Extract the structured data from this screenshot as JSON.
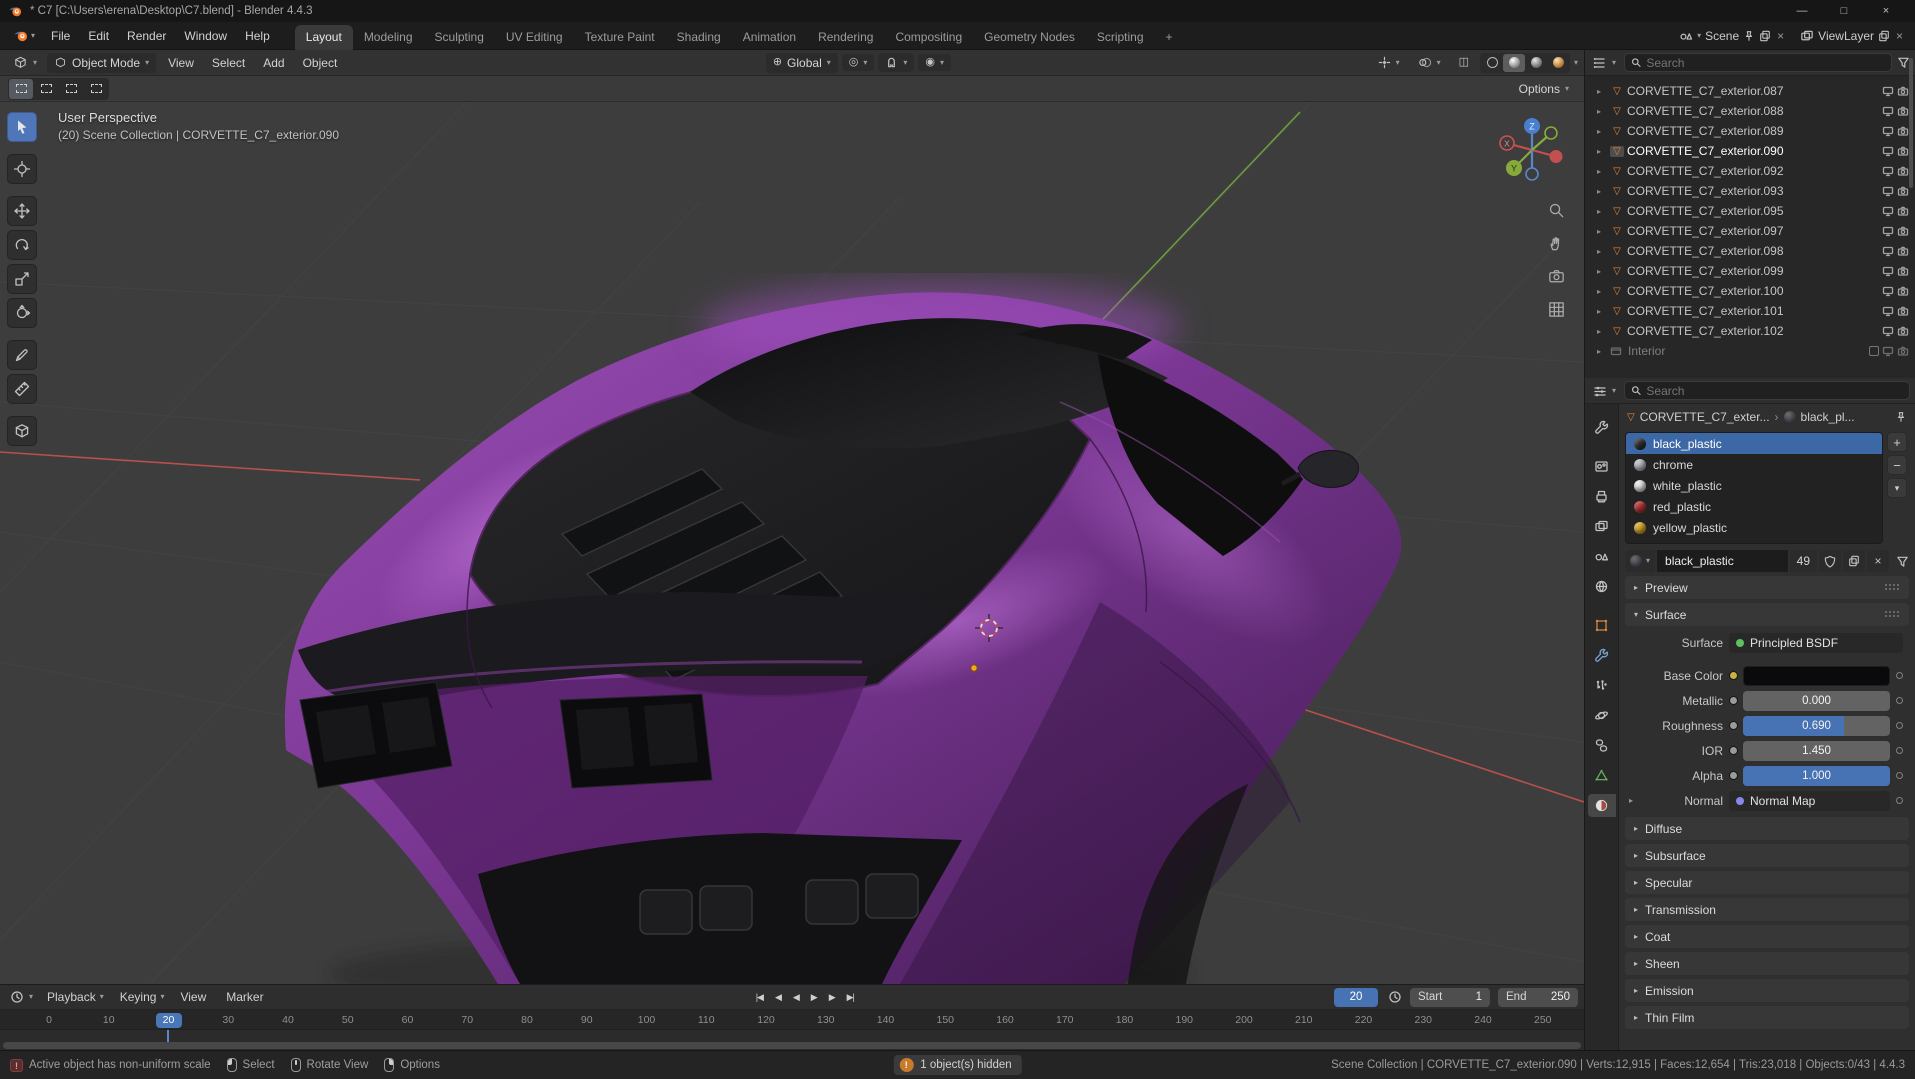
{
  "window": {
    "title": "* C7 [C:\\Users\\erena\\Desktop\\C7.blend] - Blender 4.4.3",
    "controls": {
      "minimize": "—",
      "maximize": "□",
      "close": "×"
    }
  },
  "topbar": {
    "menus": [
      "File",
      "Edit",
      "Render",
      "Window",
      "Help"
    ],
    "workspaces": [
      {
        "label": "Layout",
        "active": true
      },
      {
        "label": "Modeling"
      },
      {
        "label": "Sculpting"
      },
      {
        "label": "UV Editing"
      },
      {
        "label": "Texture Paint"
      },
      {
        "label": "Shading"
      },
      {
        "label": "Animation"
      },
      {
        "label": "Rendering"
      },
      {
        "label": "Compositing"
      },
      {
        "label": "Geometry Nodes"
      },
      {
        "label": "Scripting"
      },
      {
        "label": "+"
      }
    ],
    "scene_label": "Scene",
    "view_layer_label": "ViewLayer"
  },
  "viewport": {
    "mode": "Object Mode",
    "menus": [
      "View",
      "Select",
      "Add",
      "Object"
    ],
    "orientation": "Global",
    "options_label": "Options",
    "overlay_line1": "User Perspective",
    "overlay_line2": "(20) Scene Collection | CORVETTE_C7_exterior.090",
    "gizmo_axes": {
      "x": "X",
      "y": "Y",
      "z": "Z"
    }
  },
  "outliner": {
    "search_placeholder": "Search",
    "items": [
      {
        "label": "CORVETTE_C7_exterior.087"
      },
      {
        "label": "CORVETTE_C7_exterior.088"
      },
      {
        "label": "CORVETTE_C7_exterior.089"
      },
      {
        "label": "CORVETTE_C7_exterior.090",
        "active": true
      },
      {
        "label": "CORVETTE_C7_exterior.092"
      },
      {
        "label": "CORVETTE_C7_exterior.093"
      },
      {
        "label": "CORVETTE_C7_exterior.095"
      },
      {
        "label": "CORVETTE_C7_exterior.097"
      },
      {
        "label": "CORVETTE_C7_exterior.098"
      },
      {
        "label": "CORVETTE_C7_exterior.099"
      },
      {
        "label": "CORVETTE_C7_exterior.100"
      },
      {
        "label": "CORVETTE_C7_exterior.101"
      },
      {
        "label": "CORVETTE_C7_exterior.102"
      }
    ],
    "collection_label": "Interior"
  },
  "properties": {
    "search_placeholder": "Search",
    "breadcrumb_object": "CORVETTE_C7_exter...",
    "breadcrumb_separator": "›",
    "breadcrumb_material": "black_pl...",
    "material_slots": [
      {
        "name": "black_plastic",
        "color": "#2e2e33",
        "selected": true
      },
      {
        "name": "chrome",
        "color": "#b9bdc4"
      },
      {
        "name": "white_plastic",
        "color": "#e8e8e8"
      },
      {
        "name": "red_plastic",
        "color": "#b33434"
      },
      {
        "name": "yellow_plastic",
        "color": "#d8a92f"
      }
    ],
    "slot_buttons": {
      "add": "+",
      "remove": "−",
      "specials": "▾"
    },
    "material_name": "black_plastic",
    "material_users": "49",
    "preview_label": "Preview",
    "surface_label": "Surface",
    "surface": {
      "surface_row_label": "Surface",
      "surface_value": "Principled BSDF",
      "base_color_label": "Base Color",
      "metallic_label": "Metallic",
      "metallic_value": "0.000",
      "metallic_fill": 0,
      "roughness_label": "Roughness",
      "roughness_value": "0.690",
      "roughness_fill": 0.69,
      "ior_label": "IOR",
      "ior_value": "1.450",
      "ior_fill": 0,
      "alpha_label": "Alpha",
      "alpha_value": "1.000",
      "alpha_fill": 1,
      "normal_label": "Normal",
      "normal_value": "Normal Map"
    },
    "collapsed_panels": [
      "Diffuse",
      "Subsurface",
      "Specular",
      "Transmission",
      "Coat",
      "Sheen",
      "Emission",
      "Thin Film"
    ]
  },
  "timeline": {
    "menus": [
      {
        "label": "Playback",
        "caret": "▾"
      },
      {
        "label": "Keying",
        "caret": "▾"
      },
      {
        "label": "View",
        "caret": ""
      },
      {
        "label": "Marker",
        "caret": ""
      }
    ],
    "transport": [
      "|◀",
      "◀",
      "◀",
      "▶",
      "▶",
      "▶|"
    ],
    "current_frame": "20",
    "start_label": "Start",
    "start_value": "1",
    "end_label": "End",
    "end_value": "250",
    "ruler": [
      {
        "label": "0"
      },
      {
        "label": "10"
      },
      {
        "label": "20",
        "current": true
      },
      {
        "label": "30"
      },
      {
        "label": "40"
      },
      {
        "label": "50"
      },
      {
        "label": "60"
      },
      {
        "label": "70"
      },
      {
        "label": "80"
      },
      {
        "label": "90"
      },
      {
        "label": "100"
      },
      {
        "label": "110"
      },
      {
        "label": "120"
      },
      {
        "label": "130"
      },
      {
        "label": "140"
      },
      {
        "label": "150"
      },
      {
        "label": "160"
      },
      {
        "label": "170"
      },
      {
        "label": "180"
      },
      {
        "label": "190"
      },
      {
        "label": "200"
      },
      {
        "label": "210"
      },
      {
        "label": "220"
      },
      {
        "label": "230"
      },
      {
        "label": "240"
      },
      {
        "label": "250"
      }
    ]
  },
  "statusbar": {
    "warning": "Active object has non-uniform scale",
    "hints": [
      {
        "label": "Select"
      },
      {
        "label": "Rotate View"
      },
      {
        "label": "Options"
      }
    ],
    "notification": "1 object(s) hidden",
    "stats": "Scene Collection | CORVETTE_C7_exterior.090 | Verts:12,915 | Faces:12,654 | Tris:23,018 | Objects:0/43 | 4.4.3"
  }
}
